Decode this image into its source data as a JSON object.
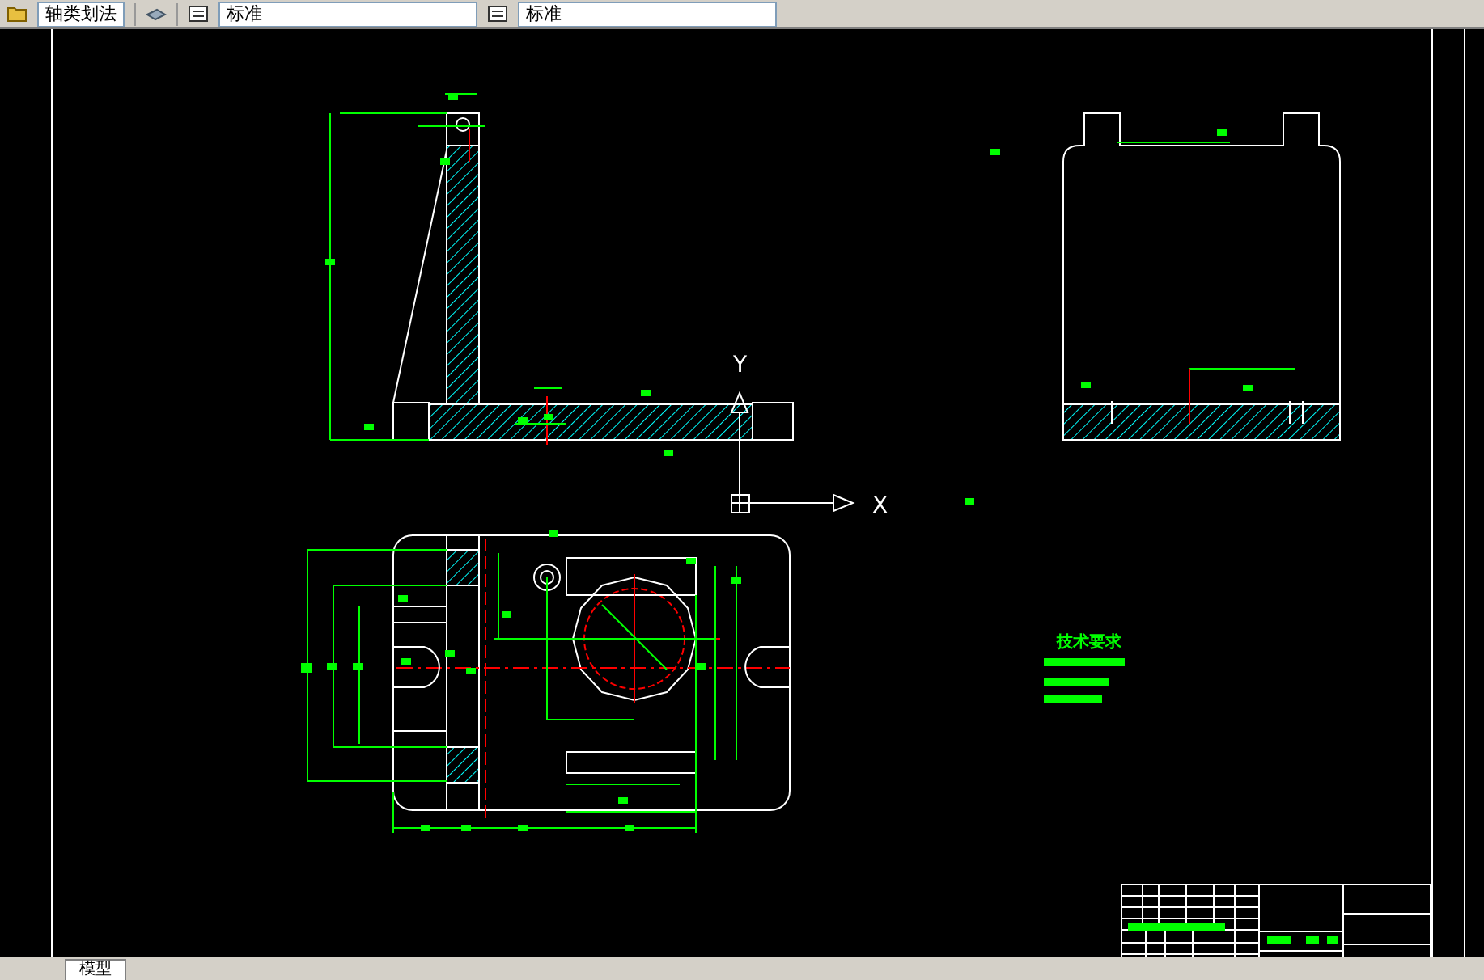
{
  "toolbar": {
    "layer_field": {
      "value": "轴类划法"
    },
    "dropdowns": [
      {
        "value": "标准"
      },
      {
        "value": "标准"
      }
    ]
  },
  "drawing": {
    "ucs_axes": {
      "x_label": "X",
      "y_label": "Y"
    },
    "notes_title": "技术要求"
  },
  "layout_tabs": [
    {
      "label": "模型",
      "selected": true
    }
  ]
}
